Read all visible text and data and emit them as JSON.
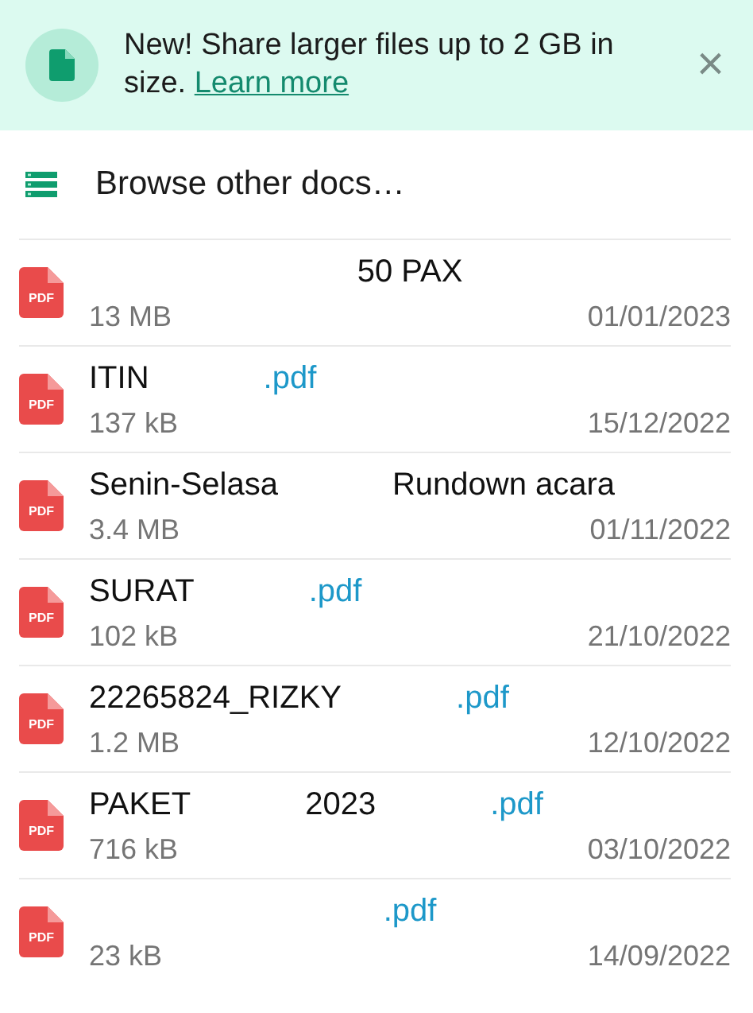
{
  "banner": {
    "message": "New! Share larger files up to 2 GB in size.",
    "link": "Learn more",
    "close": "×"
  },
  "browse": {
    "label": "Browse other docs…"
  },
  "files": [
    {
      "badge": "PDF",
      "segments": [
        {
          "text": "50 PAX",
          "kind": "name"
        }
      ],
      "size": "13 MB",
      "date": "01/01/2023"
    },
    {
      "badge": "PDF",
      "segments": [
        {
          "text": "ITIN",
          "kind": "name"
        },
        {
          "text": ".pdf",
          "kind": "extension"
        }
      ],
      "size": "137 kB",
      "date": "15/12/2022"
    },
    {
      "badge": "PDF",
      "segments": [
        {
          "text": "Senin-Selasa",
          "kind": "name"
        },
        {
          "text": "Rundown acara",
          "kind": "name"
        }
      ],
      "size": "3.4 MB",
      "date": "01/11/2022"
    },
    {
      "badge": "PDF",
      "segments": [
        {
          "text": "SURAT",
          "kind": "name"
        },
        {
          "text": ".pdf",
          "kind": "extension"
        }
      ],
      "size": "102 kB",
      "date": "21/10/2022"
    },
    {
      "badge": "PDF",
      "segments": [
        {
          "text": "22265824_RIZKY",
          "kind": "name"
        },
        {
          "text": ".pdf",
          "kind": "extension"
        }
      ],
      "size": "1.2 MB",
      "date": "12/10/2022"
    },
    {
      "badge": "PDF",
      "segments": [
        {
          "text": "PAKET",
          "kind": "name"
        },
        {
          "text": "2023",
          "kind": "name"
        },
        {
          "text": ".pdf",
          "kind": "extension"
        }
      ],
      "size": "716 kB",
      "date": "03/10/2022"
    },
    {
      "badge": "PDF",
      "segments": [
        {
          "text": ".pdf",
          "kind": "extension"
        }
      ],
      "size": "23 kB",
      "date": "14/09/2022"
    }
  ]
}
